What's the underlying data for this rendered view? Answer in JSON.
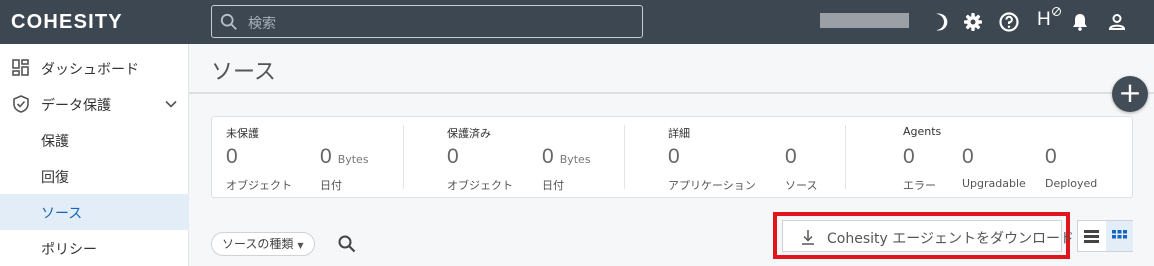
{
  "app": {
    "logo": "COHESITY"
  },
  "search": {
    "placeholder": "検索"
  },
  "header_icons": {
    "h_label": "H"
  },
  "sidebar": {
    "items": [
      {
        "label": "ダッシュボード"
      },
      {
        "label": "データ保護"
      },
      {
        "label": "保護"
      },
      {
        "label": "回復"
      },
      {
        "label": "ソース"
      },
      {
        "label": "ポリシー"
      }
    ]
  },
  "page": {
    "title": "ソース",
    "add_button": "+"
  },
  "stats": {
    "unprotected": {
      "title": "未保護",
      "objects_value": "0",
      "objects_label": "オブジェクト",
      "size_value": "0",
      "size_unit": "Bytes",
      "date_label": "日付"
    },
    "protected": {
      "title": "保護済み",
      "objects_value": "0",
      "objects_label": "オブジェクト",
      "size_value": "0",
      "size_unit": "Bytes",
      "date_label": "日付"
    },
    "details": {
      "title": "詳細",
      "apps_value": "0",
      "apps_label": "アプリケーション",
      "sources_value": "0",
      "sources_label": "ソース"
    },
    "agents": {
      "title": "Agents",
      "error_value": "0",
      "error_label": "エラー",
      "upgradable_value": "0",
      "upgradable_label": "Upgradable",
      "deployed_value": "0",
      "deployed_label": "Deployed"
    }
  },
  "toolbar": {
    "filter_chip": "ソースの種類",
    "download_label": "Cohesity エージェントをダウンロード"
  },
  "colors": {
    "topbar": "#3d4752",
    "accent": "#1565c0",
    "highlight": "#e0161f"
  }
}
